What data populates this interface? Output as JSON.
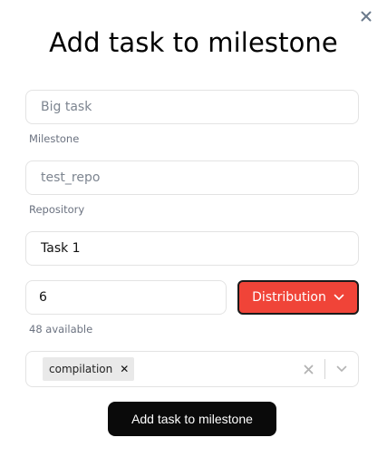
{
  "dialog": {
    "title": "Add task to milestone",
    "close_icon": "close-icon"
  },
  "milestone": {
    "value": "Big task",
    "caption": "Milestone"
  },
  "repository": {
    "value": "test_repo",
    "caption": "Repository"
  },
  "task": {
    "value": "Task 1"
  },
  "quantity": {
    "value": "6",
    "caption": "48 available"
  },
  "distribution": {
    "label": "Distribution",
    "icon": "chevron-down-icon",
    "color": "#f04438"
  },
  "tags": {
    "items": [
      {
        "label": "compilation",
        "remove_icon": "remove-tag-icon"
      }
    ],
    "clear_icon": "clear-icon",
    "dropdown_icon": "chevron-down-icon"
  },
  "submit": {
    "label": "Add task to milestone"
  }
}
